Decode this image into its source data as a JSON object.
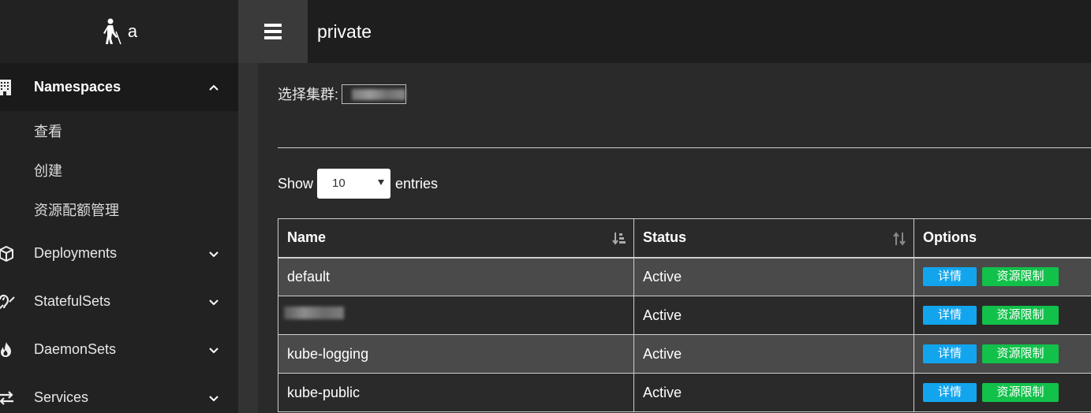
{
  "brand": {
    "name": "a",
    "logo_icon": "blind-person-icon"
  },
  "sidebar": {
    "items": [
      {
        "label": "Namespaces",
        "icon": "building-icon",
        "expanded": true,
        "children": [
          {
            "label": "查看"
          },
          {
            "label": "创建"
          },
          {
            "label": "资源配额管理"
          }
        ]
      },
      {
        "label": "Deployments",
        "icon": "cube-icon"
      },
      {
        "label": "StatefulSets",
        "icon": "deaf-icon"
      },
      {
        "label": "DaemonSets",
        "icon": "fire-icon"
      },
      {
        "label": "Services",
        "icon": "exchange-icon"
      }
    ]
  },
  "topbar": {
    "title": "private"
  },
  "cluster": {
    "label": "选择集群:",
    "value": ""
  },
  "length": {
    "show": "Show",
    "value": "10",
    "entries": "entries"
  },
  "table": {
    "headers": {
      "name": "Name",
      "status": "Status",
      "options": "Options"
    },
    "rows": [
      {
        "name": "default",
        "status": "Active"
      },
      {
        "name": "",
        "status": "Active"
      },
      {
        "name": "kube-logging",
        "status": "Active"
      },
      {
        "name": "kube-public",
        "status": "Active"
      }
    ],
    "buttons": {
      "detail": "详情",
      "limit": "资源限制"
    }
  },
  "colors": {
    "blue": "#12a5ee",
    "green": "#12c14a"
  }
}
